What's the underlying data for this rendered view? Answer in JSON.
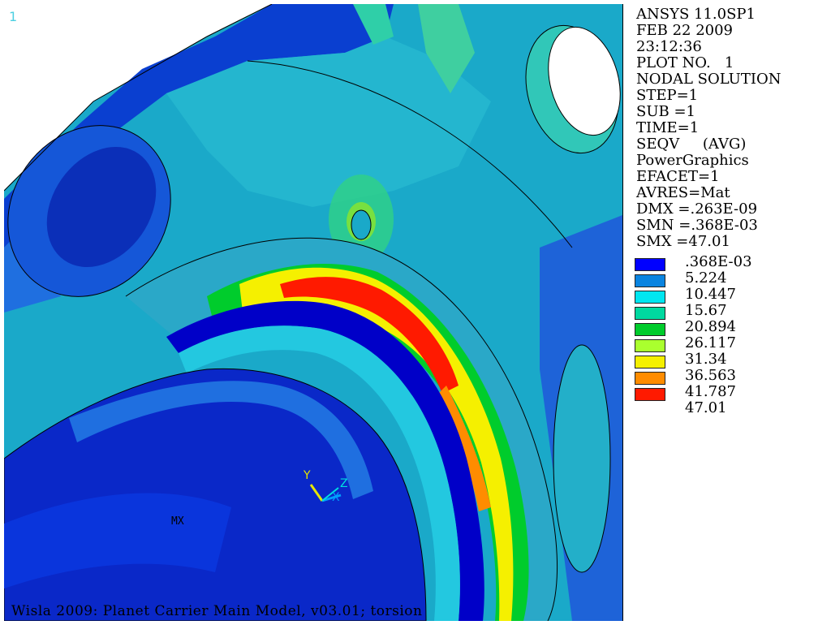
{
  "viewport": {
    "window_number": "1",
    "footer": "Wisla 2009: Planet Carrier Main Model, v03.01; torsion",
    "max_marker": "MX",
    "triad": {
      "x": "X",
      "y": "Y",
      "z": "Z"
    }
  },
  "info": {
    "lines": [
      "ANSYS 11.0SP1",
      "FEB 22 2009",
      "23:12:36",
      "PLOT NO.   1",
      "NODAL SOLUTION",
      "STEP=1",
      "SUB =1",
      "TIME=1",
      "SEQV     (AVG)",
      "PowerGraphics",
      "EFACET=1",
      "AVRES=Mat",
      "DMX =.263E-09",
      "SMN =.368E-03",
      "SMX =47.01"
    ]
  },
  "legend": {
    "labels": [
      ".368E-03",
      "5.224",
      "10.447",
      "15.67",
      "20.894",
      "26.117",
      "31.34",
      "36.563",
      "41.787",
      "47.01"
    ],
    "colors": [
      "#0000ff",
      "#0a84e0",
      "#00e6f0",
      "#00d9a0",
      "#00cc2c",
      "#aaff2e",
      "#f5f000",
      "#ff8c00",
      "#ff1a00"
    ]
  }
}
